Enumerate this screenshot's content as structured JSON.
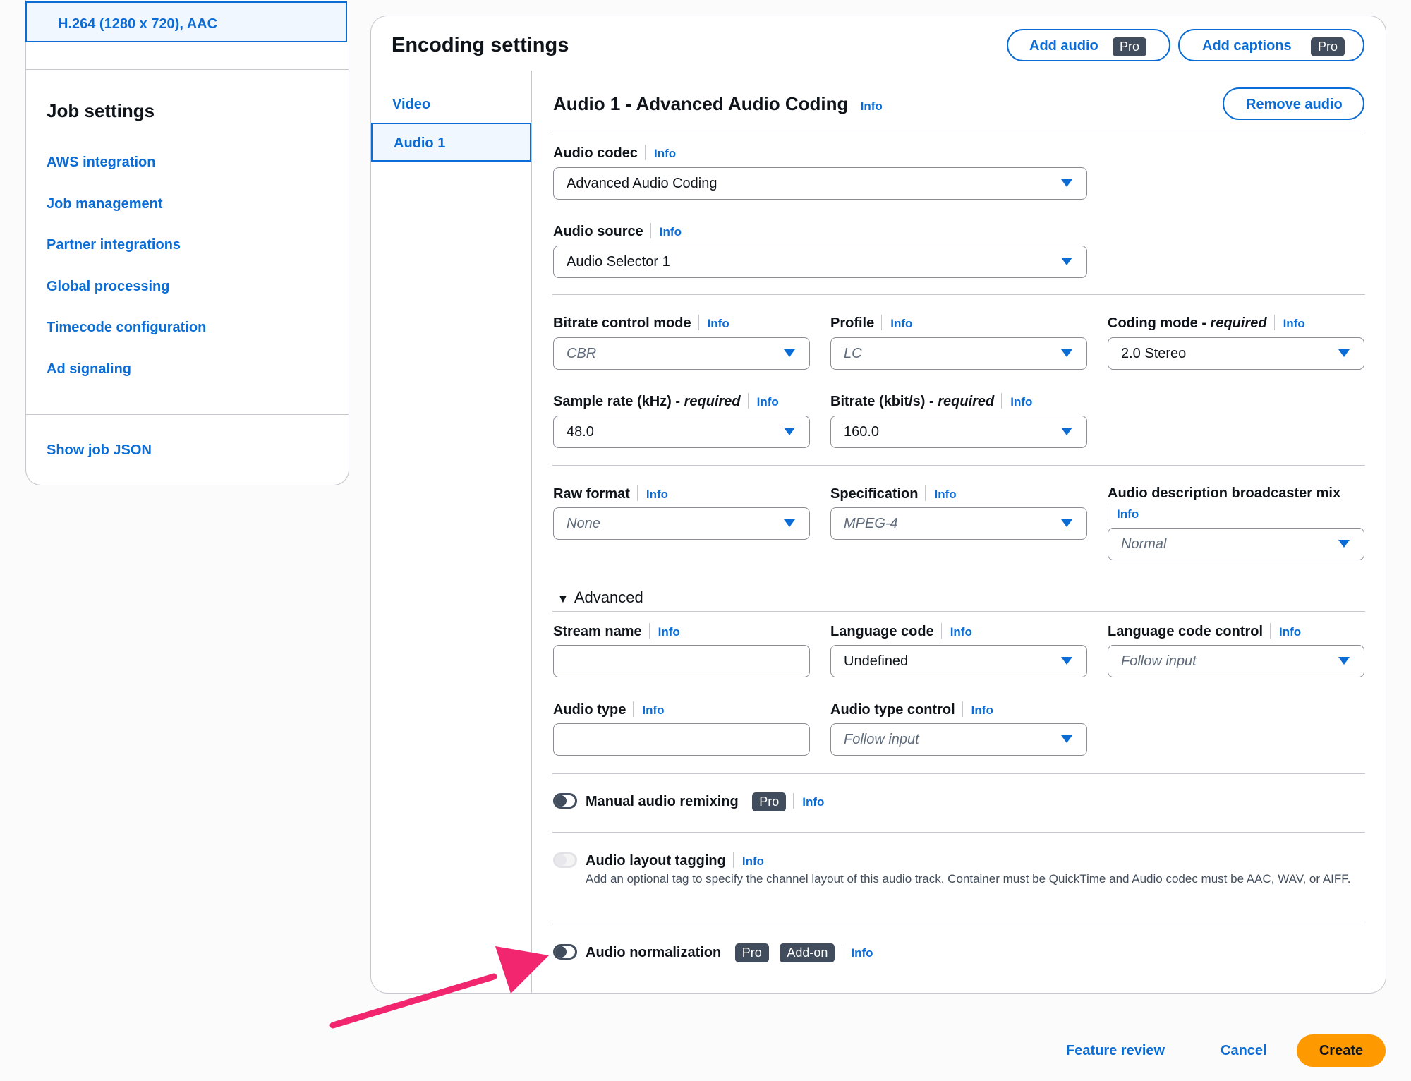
{
  "left": {
    "output_item": "H.264 (1280 x 720), AAC",
    "job_settings_title": "Job settings",
    "links": [
      "AWS integration",
      "Job management",
      "Partner integrations",
      "Global processing",
      "Timecode configuration",
      "Ad signaling"
    ],
    "show_json": "Show job JSON"
  },
  "encoding": {
    "title": "Encoding settings",
    "add_audio": "Add audio",
    "add_captions": "Add captions",
    "pro": "Pro",
    "addon": "Add-on",
    "info": "Info",
    "nav": [
      "Video",
      "Audio 1"
    ],
    "audio_title": "Audio 1 - Advanced Audio Coding",
    "remove_audio": "Remove audio",
    "fields": {
      "audio_codec": {
        "label": "Audio codec",
        "value": "Advanced Audio Coding"
      },
      "audio_source": {
        "label": "Audio source",
        "value": "Audio Selector 1"
      },
      "bitrate_control_mode": {
        "label": "Bitrate control mode",
        "value": "CBR"
      },
      "profile": {
        "label": "Profile",
        "value": "LC"
      },
      "coding_mode": {
        "label": "Coding mode - ",
        "required": "required",
        "value": "2.0 Stereo"
      },
      "sample_rate": {
        "label": "Sample rate (kHz) - ",
        "required": "required",
        "value": "48.0"
      },
      "bitrate": {
        "label": "Bitrate (kbit/s) - ",
        "required": "required",
        "value": "160.0"
      },
      "raw_format": {
        "label": "Raw format",
        "value": "None"
      },
      "specification": {
        "label": "Specification",
        "value": "MPEG-4"
      },
      "broadcaster_mix": {
        "label": "Audio description broadcaster mix",
        "value": "Normal"
      },
      "stream_name": {
        "label": "Stream name",
        "value": ""
      },
      "language_code": {
        "label": "Language code",
        "value": "Undefined"
      },
      "language_code_control": {
        "label": "Language code control",
        "value": "Follow input"
      },
      "audio_type": {
        "label": "Audio type",
        "value": ""
      },
      "audio_type_control": {
        "label": "Audio type control",
        "value": "Follow input"
      }
    },
    "advanced": "Advanced",
    "manual_remixing": "Manual audio remixing",
    "layout_tagging": "Audio layout tagging",
    "layout_tagging_desc": "Add an optional tag to specify the channel layout of this audio track. Container must be QuickTime and Audio codec must be AAC, WAV, or AIFF.",
    "normalization": "Audio normalization"
  },
  "footer": {
    "feature_review": "Feature review",
    "cancel": "Cancel",
    "create": "Create"
  },
  "colors": {
    "accent": "#0b6cd5",
    "create": "#ff9900",
    "arrow": "#f1266f"
  }
}
